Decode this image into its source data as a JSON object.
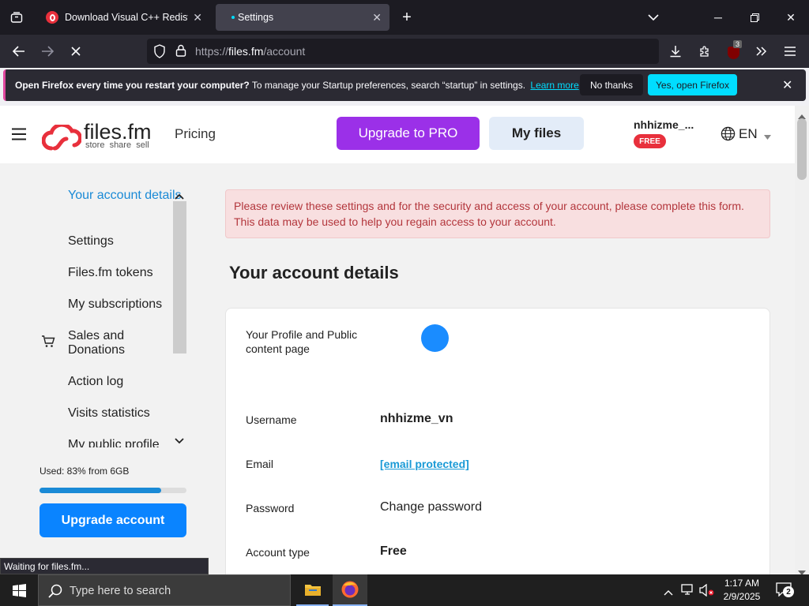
{
  "browser": {
    "tabs": [
      {
        "title": "Download Visual C++ Redistrib",
        "active": false
      },
      {
        "title": "Settings",
        "active": true
      }
    ],
    "url_prefix": "https://",
    "url_host": "files.fm",
    "url_path": "/account",
    "extension_badge": "3"
  },
  "notification": {
    "bold": "Open Firefox every time you restart your computer?",
    "text": "To manage your Startup preferences, search “startup” in settings.",
    "learn_more": "Learn more",
    "no_thanks": "No thanks",
    "yes_open": "Yes, open Firefox"
  },
  "header": {
    "logo_name": "files.fm",
    "logo_tagline": "store  share  sell",
    "pricing": "Pricing",
    "upgrade_pro": "Upgrade to PRO",
    "my_files": "My files",
    "username": "nhhizme_...",
    "plan_badge": "FREE",
    "language": "EN"
  },
  "sidebar": {
    "items": [
      {
        "label": "Your account details",
        "active": true
      },
      {
        "label": "Settings"
      },
      {
        "label": "Files.fm tokens"
      },
      {
        "label": "My subscriptions"
      },
      {
        "label": "Sales and Donations"
      },
      {
        "label": "Action log"
      },
      {
        "label": "Visits statistics"
      },
      {
        "label": "My public profile"
      }
    ],
    "usage_text": "Used: 83% from 6GB",
    "usage_fraction": 0.83,
    "upgrade_button": "Upgrade account"
  },
  "main": {
    "alert": "Please review these settings and for the security and access of your account, please complete this form. This data may be used to help you regain access to your account.",
    "heading": "Your account details",
    "profile_label": "Your Profile and Public content page",
    "fields": [
      {
        "label": "Username",
        "value": "nhhizme_vn"
      },
      {
        "label": "Email",
        "value": "[email protected]"
      },
      {
        "label": "Password",
        "value": "Change password"
      },
      {
        "label": "Account type",
        "value": "Free"
      }
    ]
  },
  "status_bar": "Waiting for files.fm...",
  "taskbar": {
    "search_placeholder": "Type here to search",
    "time": "1:17 AM",
    "date": "2/9/2025",
    "notification_count": "2"
  },
  "colors": {
    "accent_blue": "#0a84ff",
    "brand_red": "#e8303c",
    "purple": "#9b30e8",
    "link_blue": "#1a9ad6",
    "alert_bg": "#f8dfe0",
    "alert_text": "#b3363c",
    "cyan": "#00ddff"
  }
}
